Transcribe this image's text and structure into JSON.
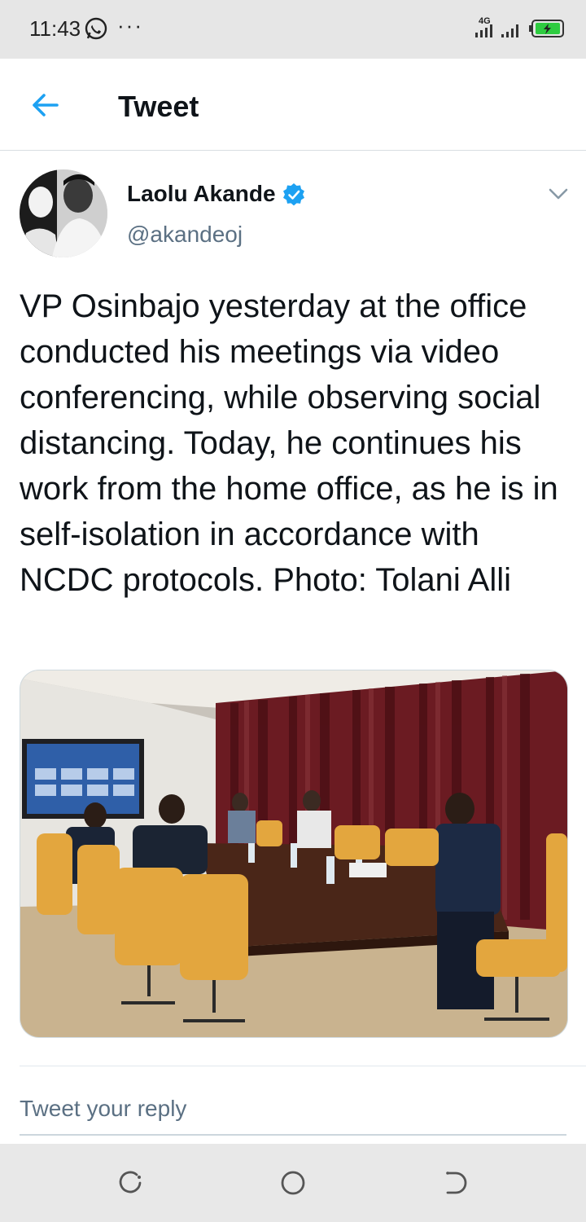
{
  "status_bar": {
    "time": "11:43",
    "more_indicator": "···",
    "network_label": "4G",
    "icons": [
      "whatsapp-icon",
      "signal-icon",
      "battery-charging-icon"
    ],
    "battery_color": "#2ecc40"
  },
  "header": {
    "title": "Tweet",
    "back_icon": "arrow-left-icon",
    "accent_color": "#1da1f2"
  },
  "tweet": {
    "author_name": "Laolu Akande",
    "author_handle": "@akandeoj",
    "verified": true,
    "verified_color": "#1da1f2",
    "text": "VP Osinbajo yesterday at the office conducted his meetings via video conferencing, while observing social distancing. Today, he continues his work from the home office, as he is in self-isolation in accordance with NCDC protocols. Photo: Tolani Alli",
    "more_icon": "chevron-down-icon"
  },
  "reply": {
    "placeholder": "Tweet your reply"
  },
  "nav_bar": {
    "icons": [
      "recent-apps-icon",
      "home-icon",
      "back-icon"
    ]
  }
}
